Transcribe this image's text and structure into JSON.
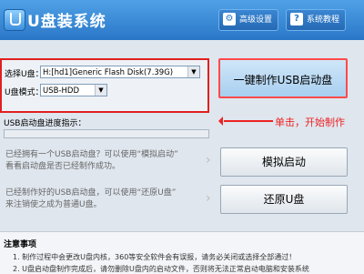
{
  "app": {
    "title": "U盘装系统"
  },
  "toolbar": {
    "advanced_label": "高级设置",
    "tutorial_label": "系统教程"
  },
  "form": {
    "select_disk_label": "选择U盘：",
    "select_disk_value": "H:[hd1]Generic Flash Disk(7.39G)",
    "mode_label": "U盘模式：",
    "mode_value": "USB-HDD"
  },
  "main": {
    "create_button": "一键制作USB启动盘",
    "annotation": "单击，开始制作",
    "progress_label": "USB启动盘进度指示："
  },
  "actions": [
    {
      "desc_line1": "已经拥有一个USB启动盘？可以使用“模拟启动”",
      "desc_line2": "看看启动盘是否已经制作成功。",
      "button": "模拟启动"
    },
    {
      "desc_line1": "已经制作好的USB启动盘，可以使用“还原U盘”",
      "desc_line2": "来注销使之成为普通U盘。",
      "button": "还原U盘"
    }
  ],
  "notes": {
    "title": "注意事项",
    "line1": "1. 制作过程中会更改U盘内核，360等安全软件会有误报，请务必关闭或选择全部通过！",
    "line2": "2. U盘启动盘制作完成后，请勿删除U盘内的启动文件，否则将无法正常启动电脑和安装系统"
  },
  "colors": {
    "titlebar": "#2a77c8",
    "highlight": "#e02020"
  }
}
